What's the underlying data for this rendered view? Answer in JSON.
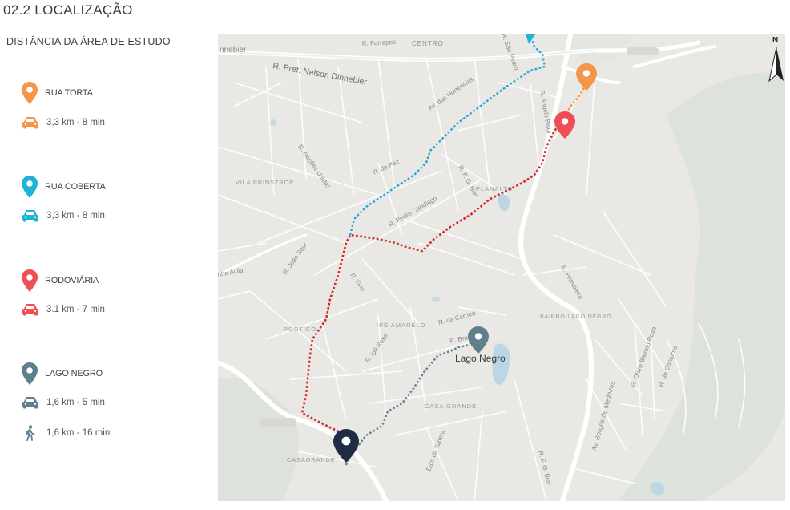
{
  "header": {
    "title": "02.2 LOCALIZAÇÃO"
  },
  "legend": {
    "title": "DISTÂNCIA DA ÁREA DE ESTUDO",
    "items": [
      {
        "label": "RUA TORTA",
        "color": "#f5954a",
        "modes": [
          {
            "icon": "car-icon",
            "text": "3,3 km - 8 min"
          }
        ]
      },
      {
        "label": "RUA COBERTA",
        "color": "#1fb4d6",
        "modes": [
          {
            "icon": "car-icon",
            "text": "3,3 km - 8 min"
          }
        ]
      },
      {
        "label": "RODOVIÁRIA",
        "color": "#ef4e56",
        "modes": [
          {
            "icon": "car-icon",
            "text": "3.1 km - 7 min"
          }
        ]
      },
      {
        "label": "LAGO NEGRO",
        "color": "#5f7f8c",
        "modes": [
          {
            "icon": "car-icon",
            "text": "1,6 km - 5 min"
          },
          {
            "icon": "walk-icon",
            "text": "1,6 km - 16 min"
          }
        ]
      }
    ]
  },
  "map": {
    "north_label": "N",
    "marker_label": "Lago Negro",
    "street_labels": {
      "l1": "nnebier",
      "l2": "R. Pref. Nelson Dinnebier",
      "l3": "R. Farrapos",
      "l4": "CENTRO",
      "l5": "VILA PRINSTROP",
      "l6": "R. Nações Unidas",
      "l7": "R. da Paz",
      "l8": "R. F. G. Bier",
      "l9": "PLANALTO",
      "l10": "R. Pedro Candiago",
      "l11": "R. João Sour",
      "l12": "R. Tirol",
      "l13": "PORTICO",
      "l14": "IPÊ AMARELO",
      "l15": "R. da Carrieri",
      "l16": "BAIRRO LAGO NEGRO",
      "l17": "R. Ipê Roxo",
      "l18": "CASA GRANDE",
      "l19": "CASAGRANDE",
      "l20": "Av. Borges de Medeiros",
      "l21": "R. Primavera",
      "l22": "R. do Contorno",
      "l23": "R. Olaro Barreto Rosa",
      "l24": "R. Angelo Bisol",
      "l25": "R. São Pedro",
      "l26": "Av. das Hortênsias",
      "l27": "R. Bruno",
      "l28": "Estr. da Tapera",
      "l29": "nha Avila",
      "l30": "R. F. G. Bier"
    }
  }
}
